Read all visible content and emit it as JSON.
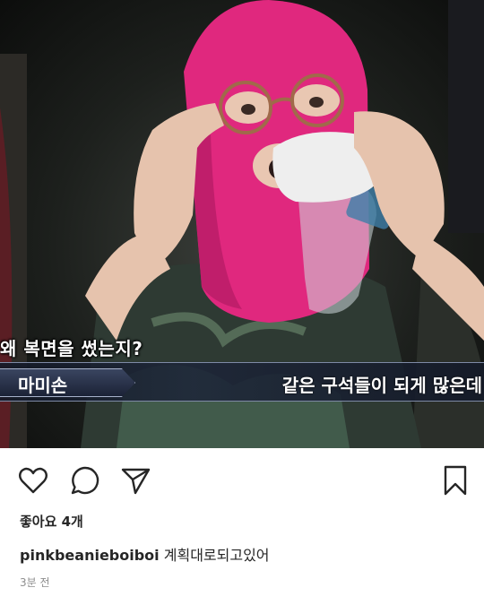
{
  "post": {
    "photo": {
      "caption_top": "왜 복면을 썼는지?",
      "name_tag": "마미손",
      "subtitle": "같은 구석들이 되게 많은데",
      "colors": {
        "mask": "#e0287e",
        "mask_shadow": "#b81c66",
        "skin": "#e9c7b2",
        "bottle_cap": "#eeeeee"
      }
    },
    "actions": {
      "like_icon": "heart-outline-icon",
      "comment_icon": "comment-bubble-icon",
      "share_icon": "paper-plane-icon",
      "save_icon": "bookmark-outline-icon"
    },
    "likes_text": "좋아요 4개",
    "caption": {
      "username": "pinkbeanieboiboi",
      "text": "계획대로되고있어"
    },
    "timestamp": "3분 전"
  }
}
